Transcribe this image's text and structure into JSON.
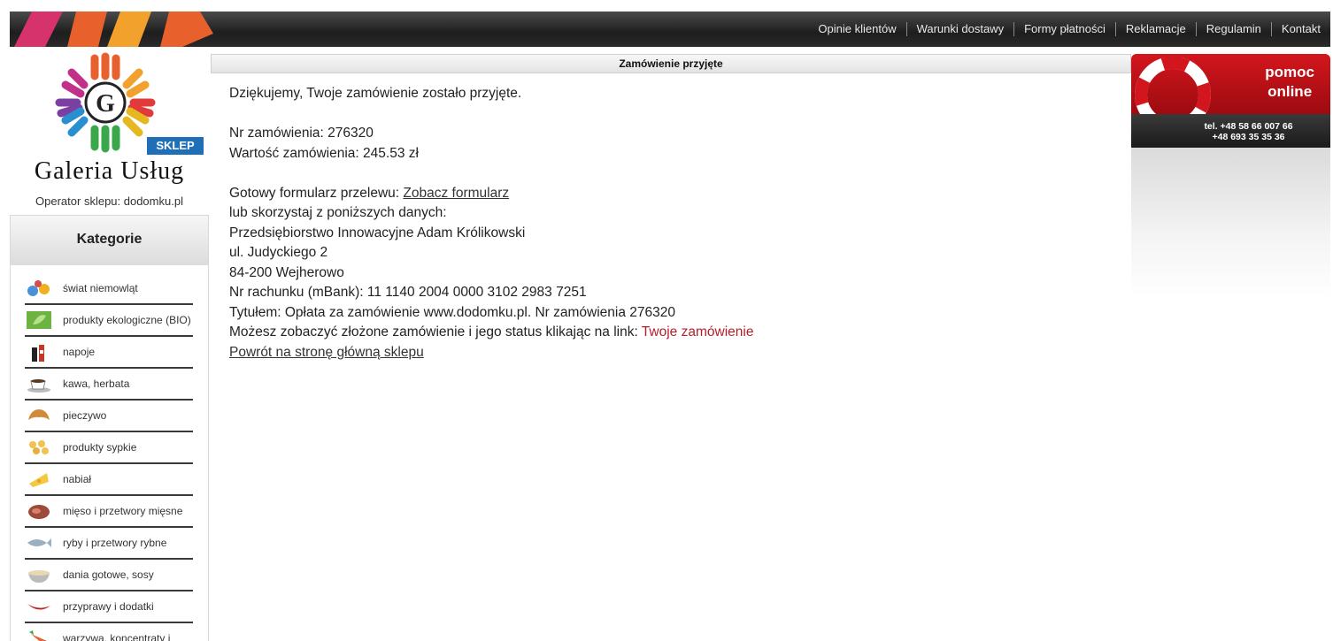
{
  "nav": {
    "links": [
      "Opinie klientów",
      "Warunki dostawy",
      "Formy płatności",
      "Reklamacje",
      "Regulamin",
      "Kontakt"
    ]
  },
  "brand": {
    "name": "Galeria Usług",
    "badge": "SKLEP",
    "operator": "Operator sklepu: dodomku.pl"
  },
  "sidebar": {
    "title": "Kategorie",
    "items": [
      {
        "label": "świat niemowląt",
        "icon": "baby-toys-icon"
      },
      {
        "label": "produkty ekologiczne (BIO)",
        "icon": "bio-leaf-icon"
      },
      {
        "label": "napoje",
        "icon": "drinks-icon"
      },
      {
        "label": "kawa, herbata",
        "icon": "coffee-cup-icon"
      },
      {
        "label": "pieczywo",
        "icon": "croissant-icon"
      },
      {
        "label": "produkty sypkie",
        "icon": "pasta-icon"
      },
      {
        "label": "nabiał",
        "icon": "cheese-icon"
      },
      {
        "label": "mięso i przetwory mięsne",
        "icon": "meat-icon"
      },
      {
        "label": "ryby i przetwory rybne",
        "icon": "fish-icon"
      },
      {
        "label": "dania gotowe, sosy",
        "icon": "bowl-icon"
      },
      {
        "label": "przyprawy i dodatki",
        "icon": "chili-icon"
      },
      {
        "label": "warzywa, koncentraty i",
        "icon": "vegetables-icon"
      }
    ]
  },
  "main": {
    "header": "Zamówienie przyjęte",
    "thanks": "Dziękujemy, Twoje zamówienie zostało przyjęte.",
    "order_number_line": "Nr zamówienia: 276320",
    "order_value_line": "Wartość zamówienia: 245.53 zł",
    "transfer_form_label": "Gotowy formularz przelewu: ",
    "transfer_form_link": "Zobacz formularz",
    "or_use": "lub skorzystaj z poniższych danych:",
    "company": "Przedsiębiorstwo Innowacyjne Adam Królikowski",
    "street": "ul. Judyckiego 2",
    "city": "84-200 Wejherowo",
    "account": "Nr rachunku (mBank): 11 1140 2004 0000 3102 2983 7251",
    "title_line": "Tytułem: Opłata za zamówienie www.dodomku.pl. Nr zamówienia 276320",
    "status_text": "Możesz zobaczyć złożone zamówienie i jego status klikając na link: ",
    "status_link": "Twoje zamówienie",
    "back_link": "Powrót na stronę główną sklepu"
  },
  "help": {
    "title_line1": "pomoc",
    "title_line2": "online",
    "phone1": "tel. +48 58 66 007 66",
    "phone2": "+48 693 35 35 36"
  },
  "colors": {
    "accent_red": "#b3202a",
    "badge_blue": "#1f6fb8",
    "topbar": "#2a2a2a"
  }
}
